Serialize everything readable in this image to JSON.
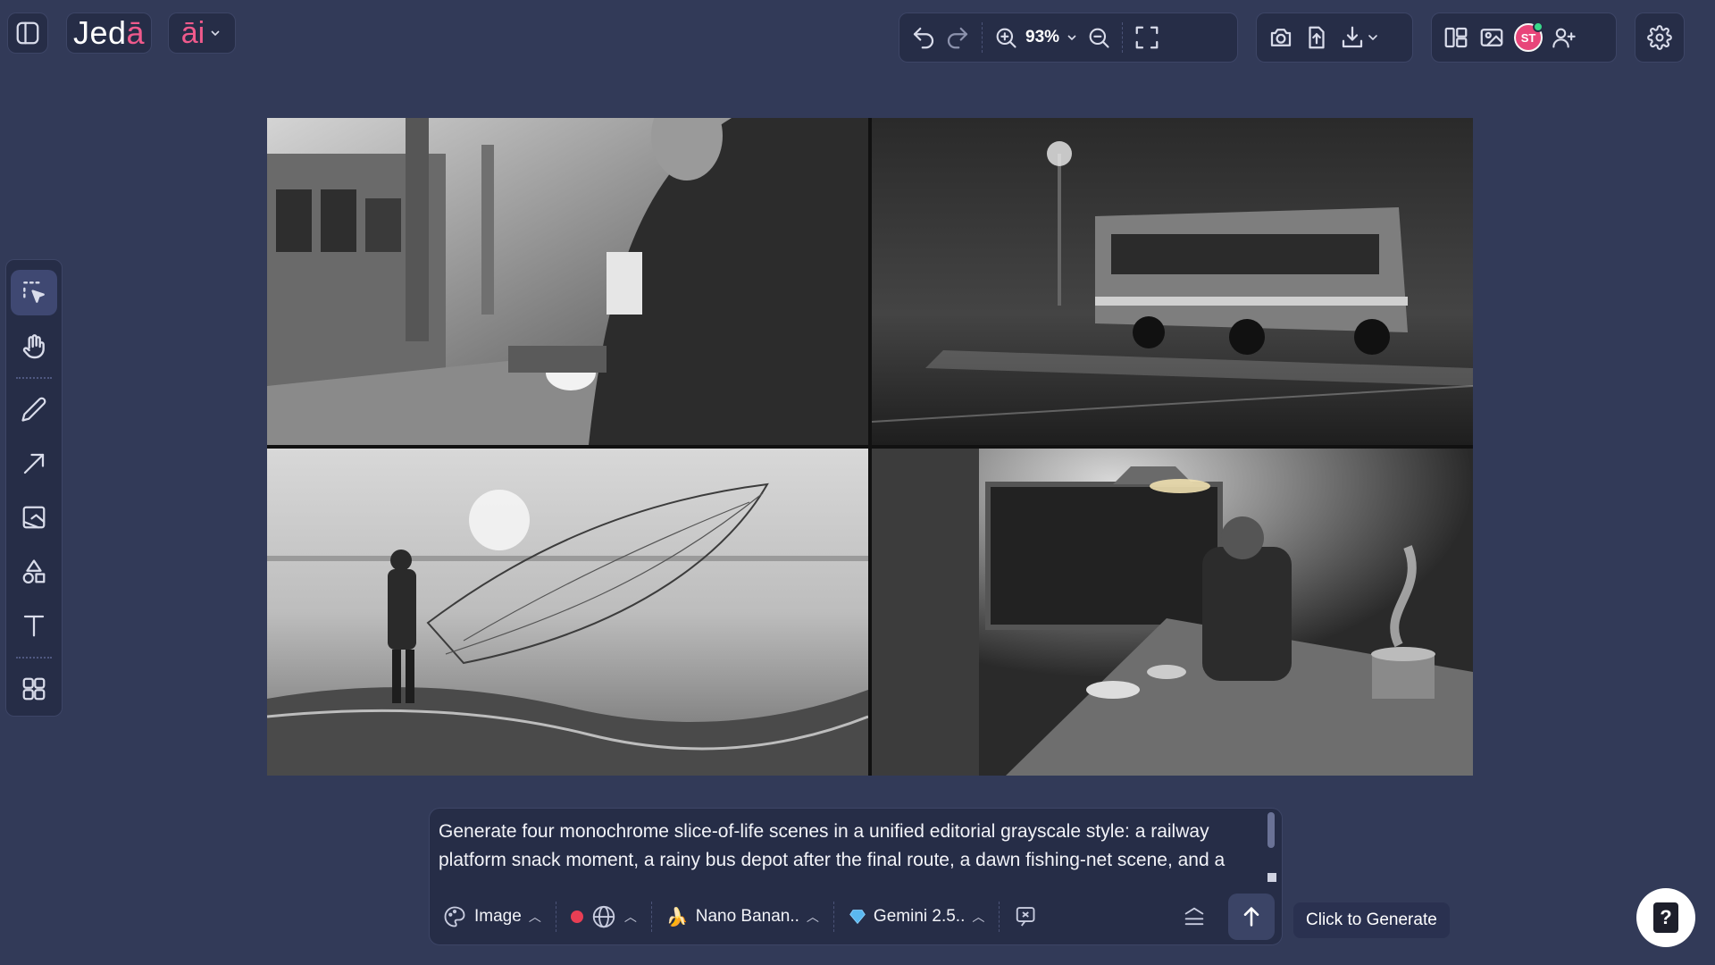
{
  "app": {
    "logo_text": "Jedā",
    "ai_label": "āi"
  },
  "toolbar": {
    "zoom": "93%",
    "avatar_initials": "ST"
  },
  "tools": [
    {
      "name": "select",
      "icon": "select-icon",
      "active": true
    },
    {
      "name": "hand",
      "icon": "hand-icon"
    },
    {
      "name": "pencil",
      "icon": "pencil-icon"
    },
    {
      "name": "arrow",
      "icon": "arrow-icon"
    },
    {
      "name": "image",
      "icon": "image-icon"
    },
    {
      "name": "shapes",
      "icon": "shapes-icon"
    },
    {
      "name": "text",
      "icon": "text-icon"
    },
    {
      "name": "components",
      "icon": "grid-icon"
    }
  ],
  "canvas": {
    "images": [
      {
        "scene": "railway platform snack moment"
      },
      {
        "scene": "rainy bus depot after the final route"
      },
      {
        "scene": "dawn fishing-net scene"
      },
      {
        "scene": "kitchen with steaming pot"
      }
    ]
  },
  "prompt": {
    "text": "Generate four monochrome slice-of-life scenes in a unified editorial grayscale style: a railway platform snack moment, a rainy bus depot after the final route, a dawn fishing-net scene, and a",
    "mode_label": "Image",
    "model_label": "Nano Banan..",
    "llm_label": "Gemini 2.5.."
  },
  "tooltip": {
    "text": "Click to Generate"
  },
  "help": {
    "label": "?"
  },
  "colors": {
    "background": "#323a58",
    "panel": "#262d47",
    "accent": "#f05a8c",
    "record": "#e83e54",
    "online": "#39d98a"
  }
}
